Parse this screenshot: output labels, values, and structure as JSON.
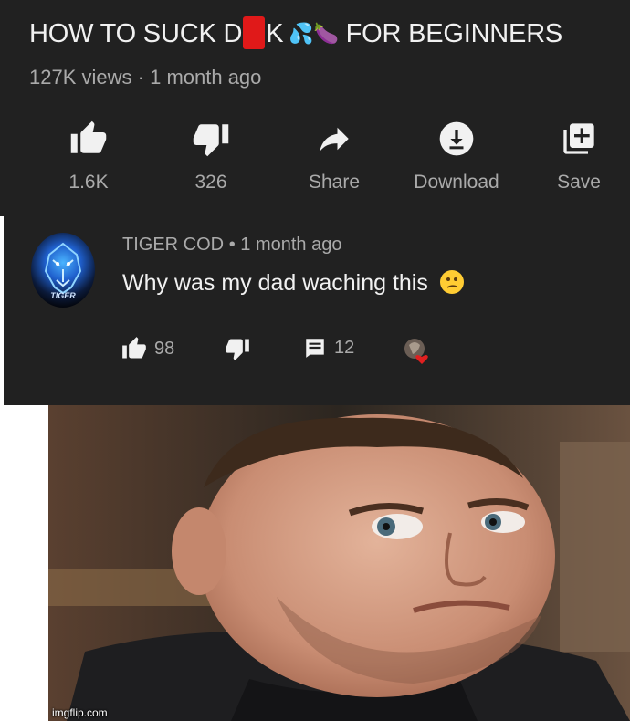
{
  "video": {
    "title_part1": "HOW TO SUCK D",
    "title_part2": "K",
    "title_emoji": "💦🍆",
    "title_part3": "FOR BEGINNERS",
    "views": "127K views",
    "separator": "·",
    "age": "1 month ago"
  },
  "actions": {
    "like": {
      "label": "1.6K",
      "icon": "thumbs-up-icon"
    },
    "dislike": {
      "label": "326",
      "icon": "thumbs-down-icon"
    },
    "share": {
      "label": "Share",
      "icon": "share-icon"
    },
    "download": {
      "label": "Download",
      "icon": "download-icon"
    },
    "save": {
      "label": "Save",
      "icon": "add-to-playlist-icon"
    }
  },
  "comment": {
    "avatar_text": "TIGER",
    "author": "TIGER COD",
    "dot": "•",
    "age": "1 month ago",
    "text": "Why was my dad waching this",
    "likes": "98",
    "replies": "12"
  },
  "watermark": "imgflip.com",
  "colors": {
    "panel_bg": "#212121",
    "text_primary": "#f1f1f1",
    "text_secondary": "#aaaaaa",
    "censor_red": "#e01919",
    "heart_red": "#e02020"
  }
}
